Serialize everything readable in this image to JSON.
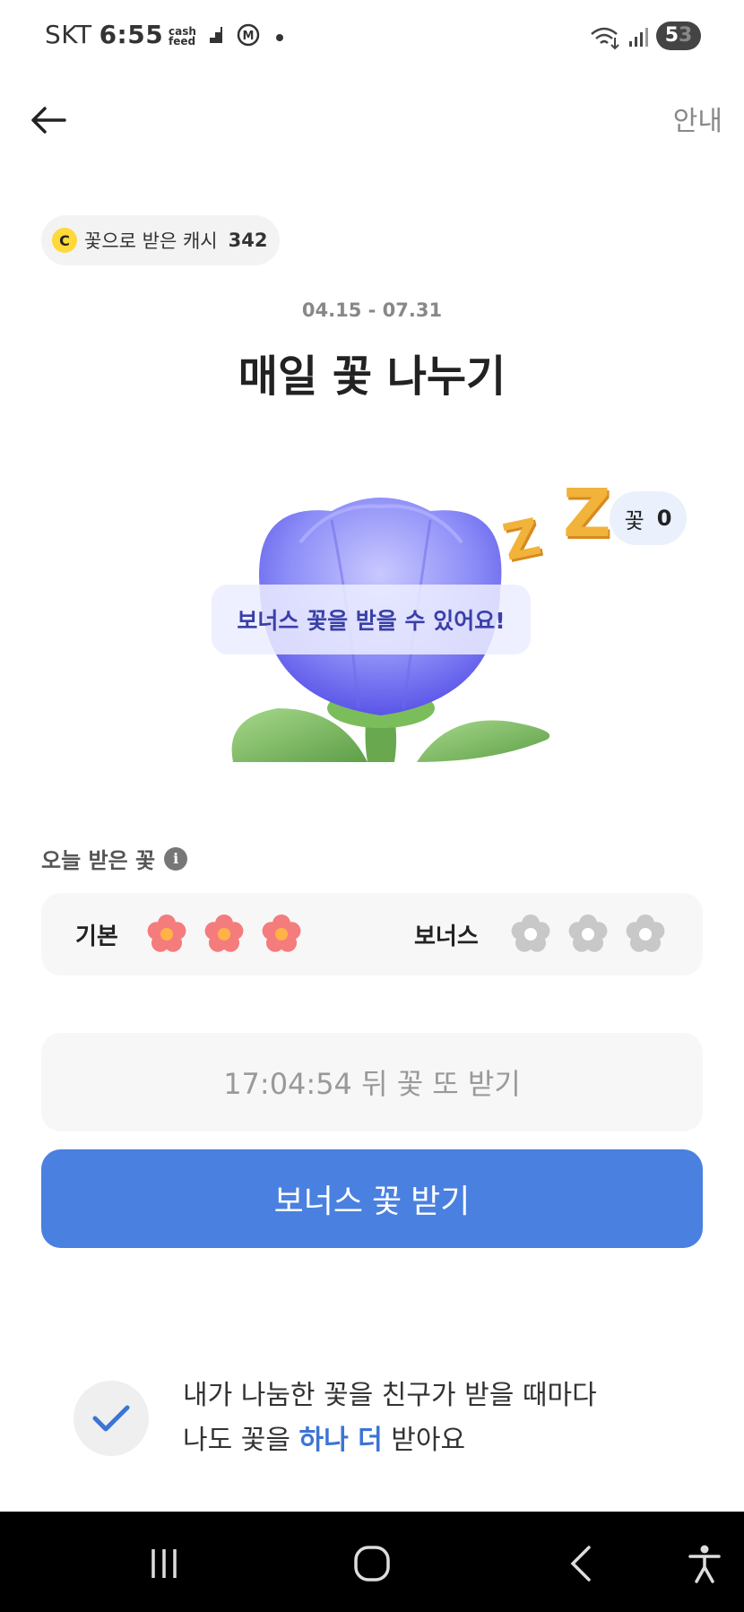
{
  "status_bar": {
    "carrier": "SKT",
    "time": "6:55",
    "app_badge_line1": "cash",
    "app_badge_line2": "feed",
    "battery_digit1": "5",
    "battery_digit2": "3"
  },
  "header": {
    "guide_label": "안내"
  },
  "cash": {
    "coin_letter": "C",
    "label": "꽃으로 받은 캐시",
    "amount": "342"
  },
  "event": {
    "period": "04.15 - 07.31",
    "title": "매일 꽃 나누기"
  },
  "illustration": {
    "zzz_small": "Z",
    "zzz_large": "Z",
    "flower_count_label": "꽃",
    "flower_count": "0",
    "bonus_message": "보너스 꽃을 받을 수 있어요!"
  },
  "today": {
    "label": "오늘 받은 꽃",
    "info_icon": "i",
    "basic_label": "기본",
    "basic_filled": 3,
    "bonus_label": "보너스",
    "bonus_filled": 0,
    "colors": {
      "filled_petal": "#f47c7c",
      "filled_center": "#ffb347",
      "empty": "#c8c8c8"
    }
  },
  "timer": {
    "text": "17:04:54 뒤 꽃 또 받기"
  },
  "bonus_button": {
    "label": "보너스 꽃 받기",
    "color": "#4a80e0"
  },
  "share": {
    "line1": "내가 나눔한 꽃을 친구가 받을 때마다",
    "line2_prefix": "나도 꽃을 ",
    "line2_highlight": "하나 더",
    "line2_suffix": " 받아요"
  }
}
